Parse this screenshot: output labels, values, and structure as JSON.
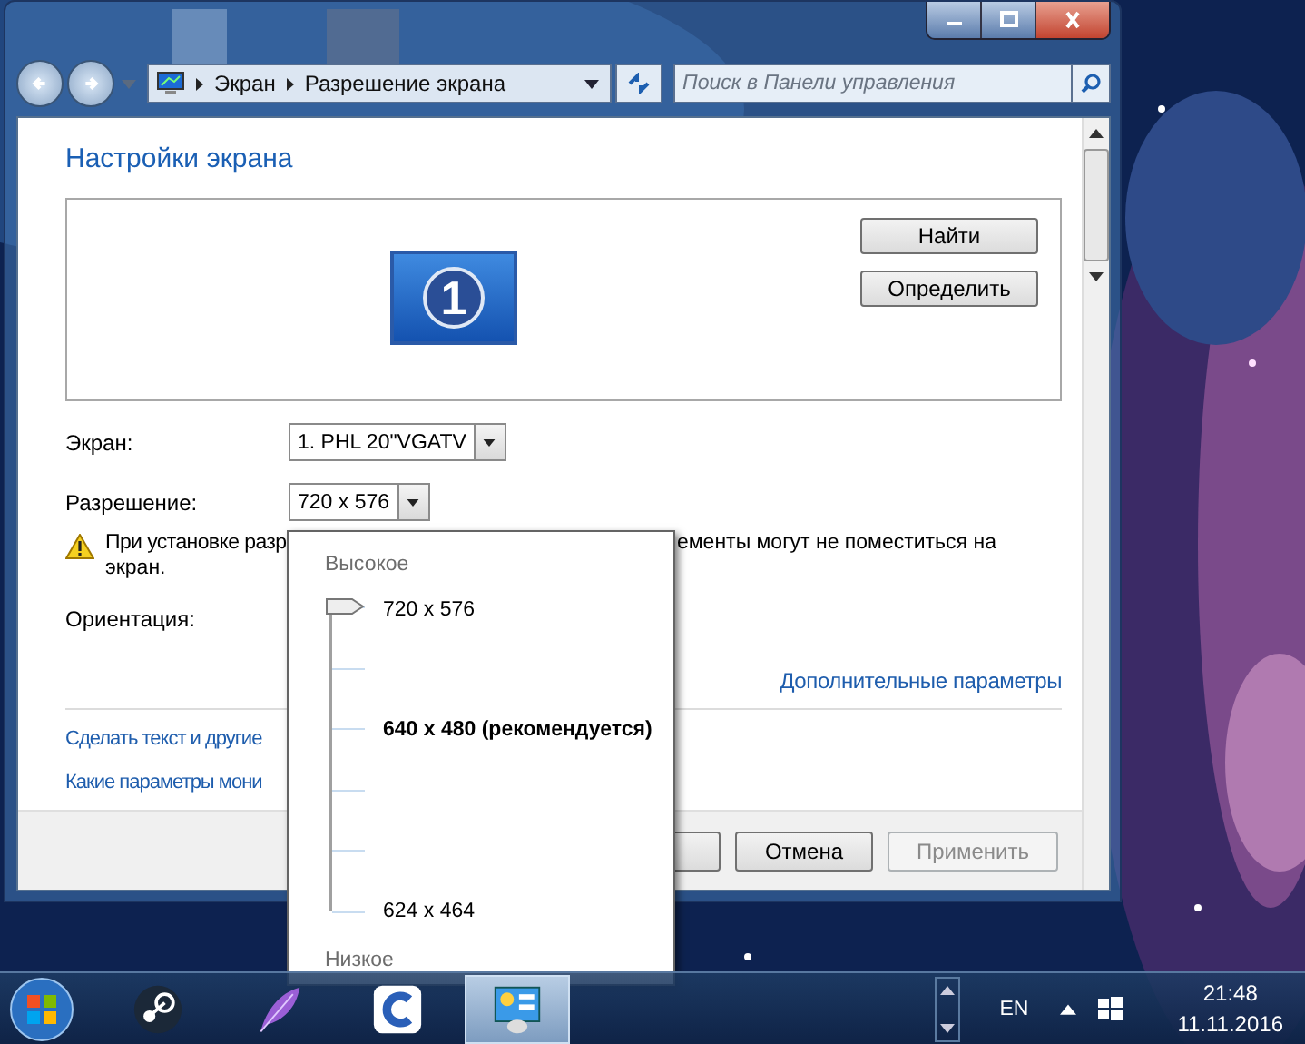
{
  "window": {
    "nav": {
      "breadcrumb": [
        "Экран",
        "Разрешение экрана"
      ],
      "search": {
        "placeholder": "Поиск в Панели управления"
      }
    },
    "heading": "Настройки экрана",
    "monitor_number": "1",
    "preview_buttons": [
      "Найти",
      "Определить"
    ],
    "fields": [
      {
        "label": "Экран:",
        "value": "1. PHL 20\"VGATV"
      },
      {
        "label": "Разрешение:",
        "value": "720 x 576"
      }
    ],
    "warning": [
      "При установке разр",
      "ементы могут не поместиться на",
      "экран."
    ],
    "orientation_label": "Ориентация:",
    "advanced_link": "Дополнительные параметры",
    "links": [
      "Сделать текст и другие",
      "Какие параметры мони"
    ],
    "buttons": [
      {
        "label": "Отмена",
        "disabled": false
      },
      {
        "label": "Применить",
        "disabled": true
      }
    ]
  },
  "resolution_popup": {
    "high_label": "Высокое",
    "low_label": "Низкое",
    "slider": {
      "level": 1
    },
    "marks": [
      {
        "label": "720 x 576",
        "recommended": false
      },
      {
        "label": "640 x 480 (рекомендуется)",
        "recommended": true
      },
      {
        "label": "624 x 464",
        "recommended": false
      }
    ]
  },
  "taskbar": {
    "apps": [
      {
        "kind": "steam",
        "active": false
      },
      {
        "kind": "feather",
        "active": false
      },
      {
        "kind": "app",
        "active": false
      },
      {
        "kind": "control-panel",
        "active": true
      }
    ],
    "language": "EN",
    "time": "21:48",
    "date": "11.11.2016"
  }
}
